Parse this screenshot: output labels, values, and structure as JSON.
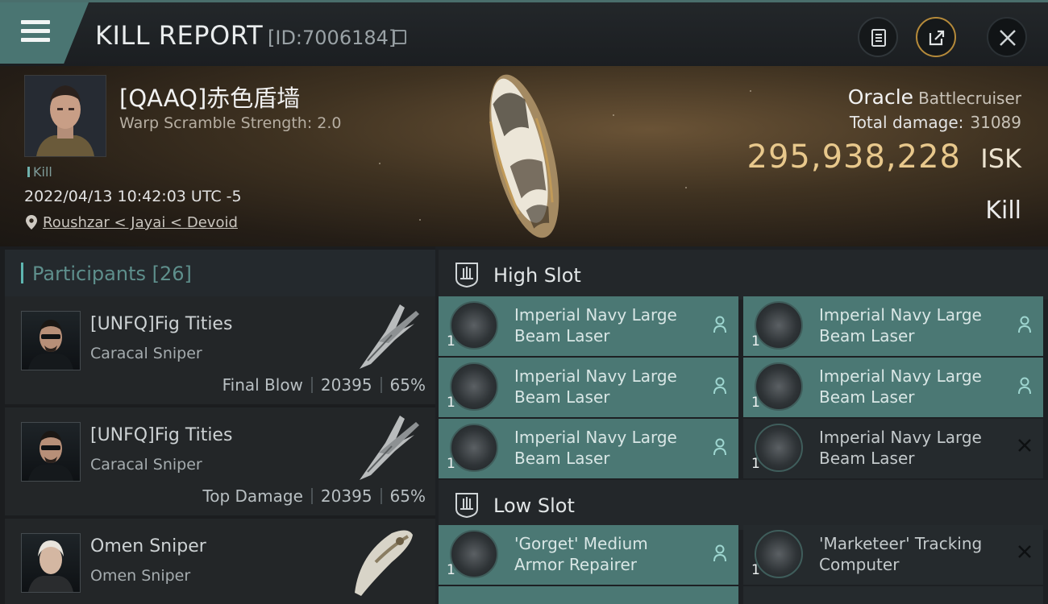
{
  "header": {
    "title": "KILL REPORT",
    "report_id": "[ID:7006184]"
  },
  "victim": {
    "name": "[QAAQ]赤色盾墙",
    "warp_scramble": "Warp Scramble Strength: 2.0",
    "tag": "Kill",
    "timestamp": "2022/04/13 10:42:03 UTC -5",
    "location": "Roushzar < Jayai < Devoid"
  },
  "ship": {
    "name": "Oracle",
    "class": "Battlecruiser",
    "total_damage_label": "Total damage:",
    "total_damage": "31089",
    "isk_value": "295,938,228",
    "isk_unit": "ISK",
    "result": "Kill"
  },
  "participants": {
    "label": "Participants [26]",
    "items": [
      {
        "name": "[UNFQ]Fig Tities",
        "ship": "Caracal Sniper",
        "role": "Final Blow",
        "damage": "20395",
        "percent": "65%"
      },
      {
        "name": "[UNFQ]Fig Tities",
        "ship": "Caracal Sniper",
        "role": "Top Damage",
        "damage": "20395",
        "percent": "65%"
      },
      {
        "name": "Omen Sniper",
        "ship": "Omen Sniper"
      }
    ]
  },
  "slots": {
    "high": {
      "label": "High Slot",
      "modules": [
        {
          "name": "Imperial Navy Large Beam Laser",
          "qty": "1",
          "status": "dropped"
        },
        {
          "name": "Imperial Navy Large Beam Laser",
          "qty": "1",
          "status": "dropped"
        },
        {
          "name": "Imperial Navy Large Beam Laser",
          "qty": "1",
          "status": "dropped"
        },
        {
          "name": "Imperial Navy Large Beam Laser",
          "qty": "1",
          "status": "dropped"
        },
        {
          "name": "Imperial Navy Large Beam Laser",
          "qty": "1",
          "status": "dropped"
        },
        {
          "name": "Imperial Navy Large Beam Laser",
          "qty": "1",
          "status": "destroyed"
        }
      ]
    },
    "low": {
      "label": "Low Slot",
      "modules": [
        {
          "name": "'Gorget' Medium Armor Repairer",
          "qty": "1",
          "status": "dropped"
        },
        {
          "name": "'Marketeer' Tracking Computer",
          "qty": "1",
          "status": "destroyed"
        }
      ]
    }
  },
  "colors": {
    "accent": "#4b7874",
    "isk": "#e8c88c",
    "participant_accent": "#5fb6b0"
  }
}
